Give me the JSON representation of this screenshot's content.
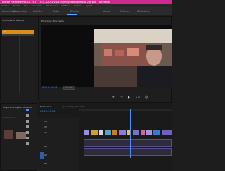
{
  "window": {
    "title": "Adobe Premiere Pro CC 2017 - C:\\...\\DOCEVIDEOS\\Proyecto Aprendiz 2.prproj - Alterado"
  },
  "menu": [
    "Archivo",
    "Edición",
    "Clip",
    "Secuencia",
    "Marcadores",
    "Gráficos",
    "Ventana",
    "Ayuda"
  ],
  "workspaces": [
    "Aprendizaje",
    "Ensamblaje",
    "Edición",
    "Color",
    "Efectos",
    "Audio",
    "Gráficos",
    "Bibliotecas"
  ],
  "active_workspace": "Color",
  "source_panel": {
    "tab": "Controles de efectos",
    "tab2": "Mezclador de clip de audio",
    "track_label": "A1"
  },
  "program": {
    "tab": "Programa: Entrevista",
    "timecode": "00:10:39:16",
    "fit": "Ajustar",
    "zoom": "Completa",
    "duration": "00:24:14:08"
  },
  "project": {
    "tab": "Proyecto: Proyecto Aprendiz",
    "items": "5 elementos"
  },
  "timeline": {
    "tab": "Entrevista",
    "tab2": "Aprendizaje del editor",
    "timecode": "00:10:39:16",
    "tracks": [
      "V3",
      "V2",
      "V1",
      "A1",
      "A2",
      "A3"
    ]
  },
  "colors": {
    "accent": "#4d8cff",
    "titlebar": "#cf2a8e",
    "selection": "#d98e1a"
  },
  "icons": [
    "play-icon",
    "step-back-icon",
    "step-forward-icon",
    "marker-icon",
    "wrench-icon",
    "selection-tool-icon",
    "razor-tool-icon",
    "hand-tool-icon"
  ]
}
